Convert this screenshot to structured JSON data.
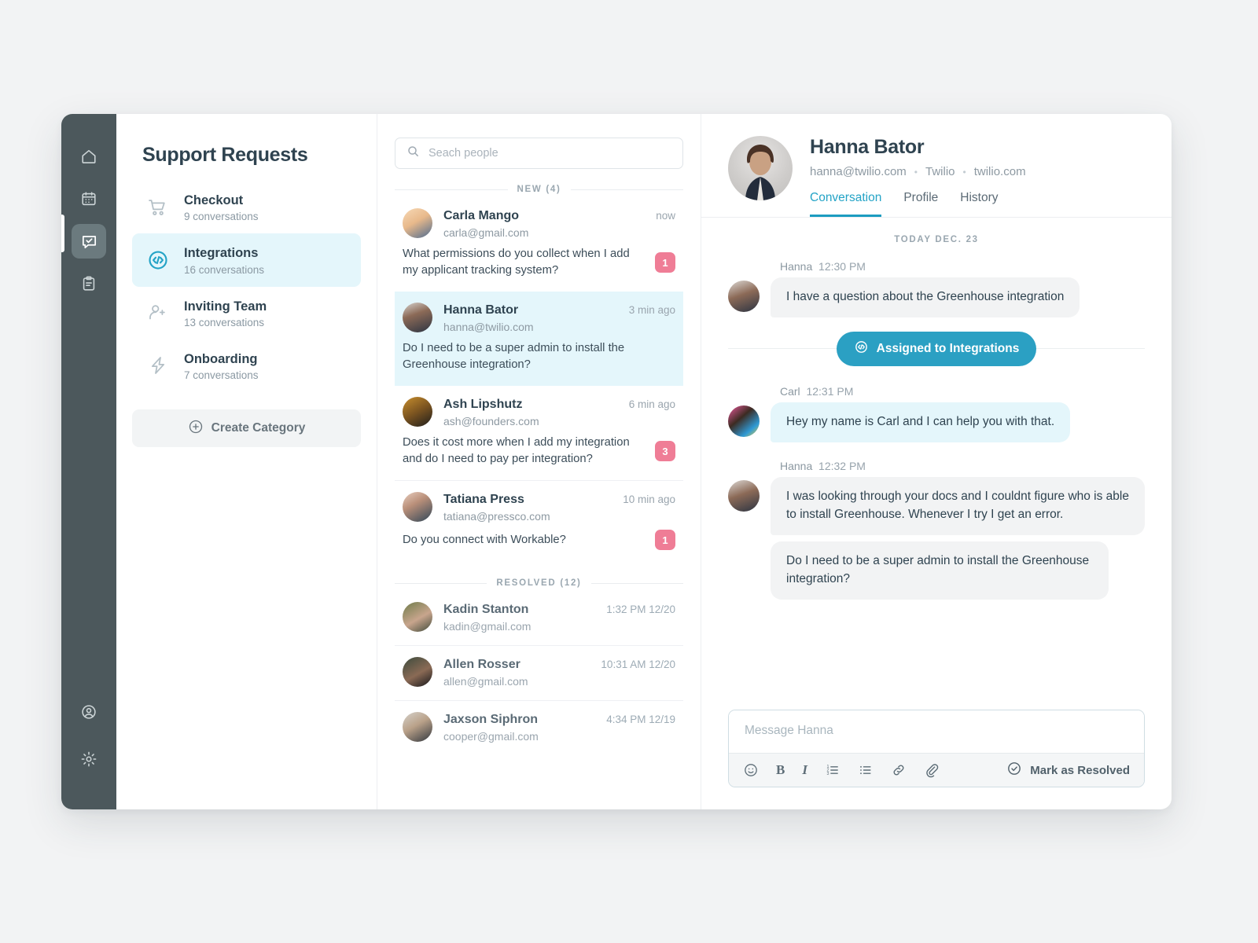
{
  "rail": {
    "items": [
      {
        "icon": "home-icon",
        "active": false
      },
      {
        "icon": "calendar-icon",
        "active": false
      },
      {
        "icon": "chat-check-icon",
        "active": true
      },
      {
        "icon": "clipboard-icon",
        "active": false
      }
    ],
    "bottom_items": [
      {
        "icon": "user-circle-icon"
      },
      {
        "icon": "gear-icon"
      }
    ]
  },
  "categories_panel": {
    "title": "Support Requests",
    "items": [
      {
        "icon": "cart-icon",
        "name": "Checkout",
        "sub": "9 conversations",
        "active": false
      },
      {
        "icon": "code-circle-icon",
        "name": "Integrations",
        "sub": "16 conversations",
        "active": true
      },
      {
        "icon": "user-plus-icon",
        "name": "Inviting Team",
        "sub": "13 conversations",
        "active": false
      },
      {
        "icon": "bolt-icon",
        "name": "Onboarding",
        "sub": "7 conversations",
        "active": false
      }
    ],
    "create_button": "Create Category"
  },
  "list_panel": {
    "search": {
      "placeholder": "Seach people",
      "value": ""
    },
    "new_label": "NEW (4)",
    "resolved_label": "RESOLVED (12)",
    "new_items": [
      {
        "name": "Carla Mango",
        "email": "carla@gmail.com",
        "time": "now",
        "message": "What permissions do you collect when I add my applicant tracking system?",
        "badge": "1",
        "selected": false
      },
      {
        "name": "Hanna Bator",
        "email": "hanna@twilio.com",
        "time": "3 min ago",
        "message": "Do I need to be a super admin to install the Greenhouse integration?",
        "badge": "",
        "selected": true
      },
      {
        "name": "Ash Lipshutz",
        "email": "ash@founders.com",
        "time": "6 min ago",
        "message": "Does it cost more when I add my integration and do I need to pay per integration?",
        "badge": "3",
        "selected": false
      },
      {
        "name": "Tatiana Press",
        "email": "tatiana@pressco.com",
        "time": "10 min ago",
        "message": "Do you connect with Workable?",
        "badge": "1",
        "selected": false
      }
    ],
    "resolved_items": [
      {
        "name": "Kadin Stanton",
        "email": "kadin@gmail.com",
        "time": "1:32 PM  12/20"
      },
      {
        "name": "Allen Rosser",
        "email": "allen@gmail.com",
        "time": "10:31 AM  12/20"
      },
      {
        "name": "Jaxson Siphron",
        "email": "cooper@gmail.com",
        "time": "4:34 PM  12/19"
      }
    ]
  },
  "chat_panel": {
    "contact_name": "Hanna Bator",
    "contact_email": "hanna@twilio.com",
    "contact_company": "Twilio",
    "contact_site": "twilio.com",
    "tabs": [
      {
        "label": "Conversation",
        "active": true
      },
      {
        "label": "Profile",
        "active": false
      },
      {
        "label": "History",
        "active": false
      }
    ],
    "day_label": "TODAY DEC. 23",
    "messages": [
      {
        "author": "Hanna",
        "time": "12:30 PM",
        "side": "customer",
        "bubbles": [
          "I have a question about the Greenhouse integration"
        ]
      },
      {
        "author": "Carl",
        "time": "12:31 PM",
        "side": "agent",
        "bubbles": [
          "Hey my name is Carl and I can help you with that."
        ]
      },
      {
        "author": "Hanna",
        "time": "12:32 PM",
        "side": "customer",
        "bubbles": [
          "I was looking through your docs and I couldnt figure who is able to install Greenhouse. Whenever I try I get an error.",
          "Do I need to be a super admin to install the Greenhouse integration?"
        ]
      }
    ],
    "assignment": {
      "label": "Assigned to Integrations",
      "icon": "code-circle-icon"
    },
    "composer": {
      "placeholder": "Message Hanna",
      "value": "",
      "tools": [
        "emoji-icon",
        "bold-icon",
        "italic-icon",
        "ordered-list-icon",
        "bullet-list-icon",
        "link-icon",
        "attachment-icon"
      ],
      "resolve_label": "Mark as Resolved"
    }
  },
  "colors": {
    "rail_bg": "#4c585c",
    "accent": "#23a3c6",
    "accent_pill": "#2ba0c3",
    "accent_soft": "#e4f6fb",
    "badge_pink": "#ef7d96",
    "text_dark": "#2f4350",
    "text_muted": "#8d99a2",
    "page_bg": "#f2f3f4"
  }
}
